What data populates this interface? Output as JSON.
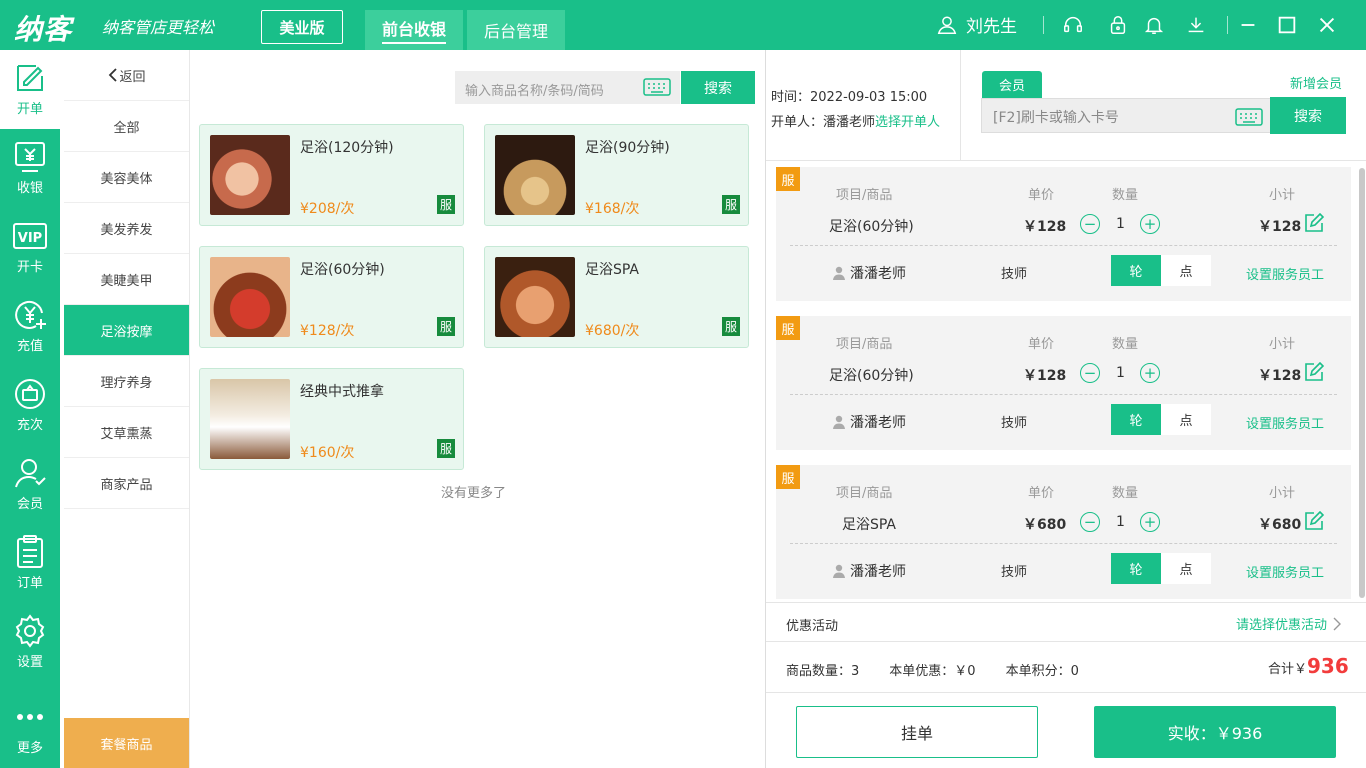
{
  "app": {
    "logo": "纳客",
    "slogan": "纳客管店更轻松",
    "edition": "美业版",
    "tabs": [
      "前台收银",
      "后台管理"
    ],
    "user": "刘先生"
  },
  "nav": [
    {
      "label": "开单",
      "icon": "edit-icon"
    },
    {
      "label": "收银",
      "icon": "cashier-icon"
    },
    {
      "label": "开卡",
      "icon": "vip-card-icon"
    },
    {
      "label": "充值",
      "icon": "recharge-icon"
    },
    {
      "label": "充次",
      "icon": "recharge-times-icon"
    },
    {
      "label": "会员",
      "icon": "member-icon"
    },
    {
      "label": "订单",
      "icon": "order-icon"
    },
    {
      "label": "设置",
      "icon": "settings-icon"
    },
    {
      "label": "更多",
      "icon": "more-icon"
    }
  ],
  "categories": {
    "back": "返回",
    "items": [
      "全部",
      "美容美体",
      "美发养发",
      "美睫美甲",
      "足浴按摩",
      "理疗养身",
      "艾草熏蒸",
      "商家产品"
    ],
    "active": "足浴按摩",
    "package": "套餐商品"
  },
  "search": {
    "placeholder": "输入商品名称/条码/简码",
    "button": "搜索"
  },
  "products": [
    {
      "name": "足浴(120分钟)",
      "price": "¥208/次",
      "tag": "服"
    },
    {
      "name": "足浴(90分钟)",
      "price": "¥168/次",
      "tag": "服"
    },
    {
      "name": "足浴(60分钟)",
      "price": "¥128/次",
      "tag": "服"
    },
    {
      "name": "足浴SPA",
      "price": "¥680/次",
      "tag": "服"
    },
    {
      "name": "经典中式推拿",
      "price": "¥160/次",
      "tag": "服"
    }
  ],
  "no_more": "没有更多了",
  "order_info": {
    "time_label": "时间：",
    "time": "2022-09-03 15:00",
    "operator_label": "开单人：",
    "operator": "潘潘老师",
    "select_operator": "选择开单人"
  },
  "member": {
    "tab": "会员",
    "new": "新增会员",
    "placeholder": "[F2]刷卡或输入卡号",
    "button": "搜索"
  },
  "order_headers": {
    "item": "项目/商品",
    "price": "单价",
    "qty": "数量",
    "subtotal": "小计"
  },
  "order_items": [
    {
      "tag": "服",
      "name": "足浴(60分钟)",
      "price": "￥128",
      "qty": "1",
      "subtotal": "￥128",
      "staff": "潘潘老师",
      "role": "技师",
      "mode_a": "轮",
      "mode_b": "点",
      "set_staff": "设置服务员工"
    },
    {
      "tag": "服",
      "name": "足浴(60分钟)",
      "price": "￥128",
      "qty": "1",
      "subtotal": "￥128",
      "staff": "潘潘老师",
      "role": "技师",
      "mode_a": "轮",
      "mode_b": "点",
      "set_staff": "设置服务员工"
    },
    {
      "tag": "服",
      "name": "足浴SPA",
      "price": "￥680",
      "qty": "1",
      "subtotal": "￥680",
      "staff": "潘潘老师",
      "role": "技师",
      "mode_a": "轮",
      "mode_b": "点",
      "set_staff": "设置服务员工"
    }
  ],
  "promo": {
    "label": "优惠活动",
    "select": "请选择优惠活动"
  },
  "summary": {
    "count": "商品数量：3",
    "discount": "本单优惠：￥0",
    "points": "本单积分：0",
    "total_label": "合计￥",
    "total": "936"
  },
  "actions": {
    "hang": "挂单",
    "pay": "实收：￥936"
  },
  "colors": {
    "primary": "#19bf89",
    "orange": "#ef8a1b",
    "tag": "#178b3d",
    "total": "#f23c3c"
  }
}
